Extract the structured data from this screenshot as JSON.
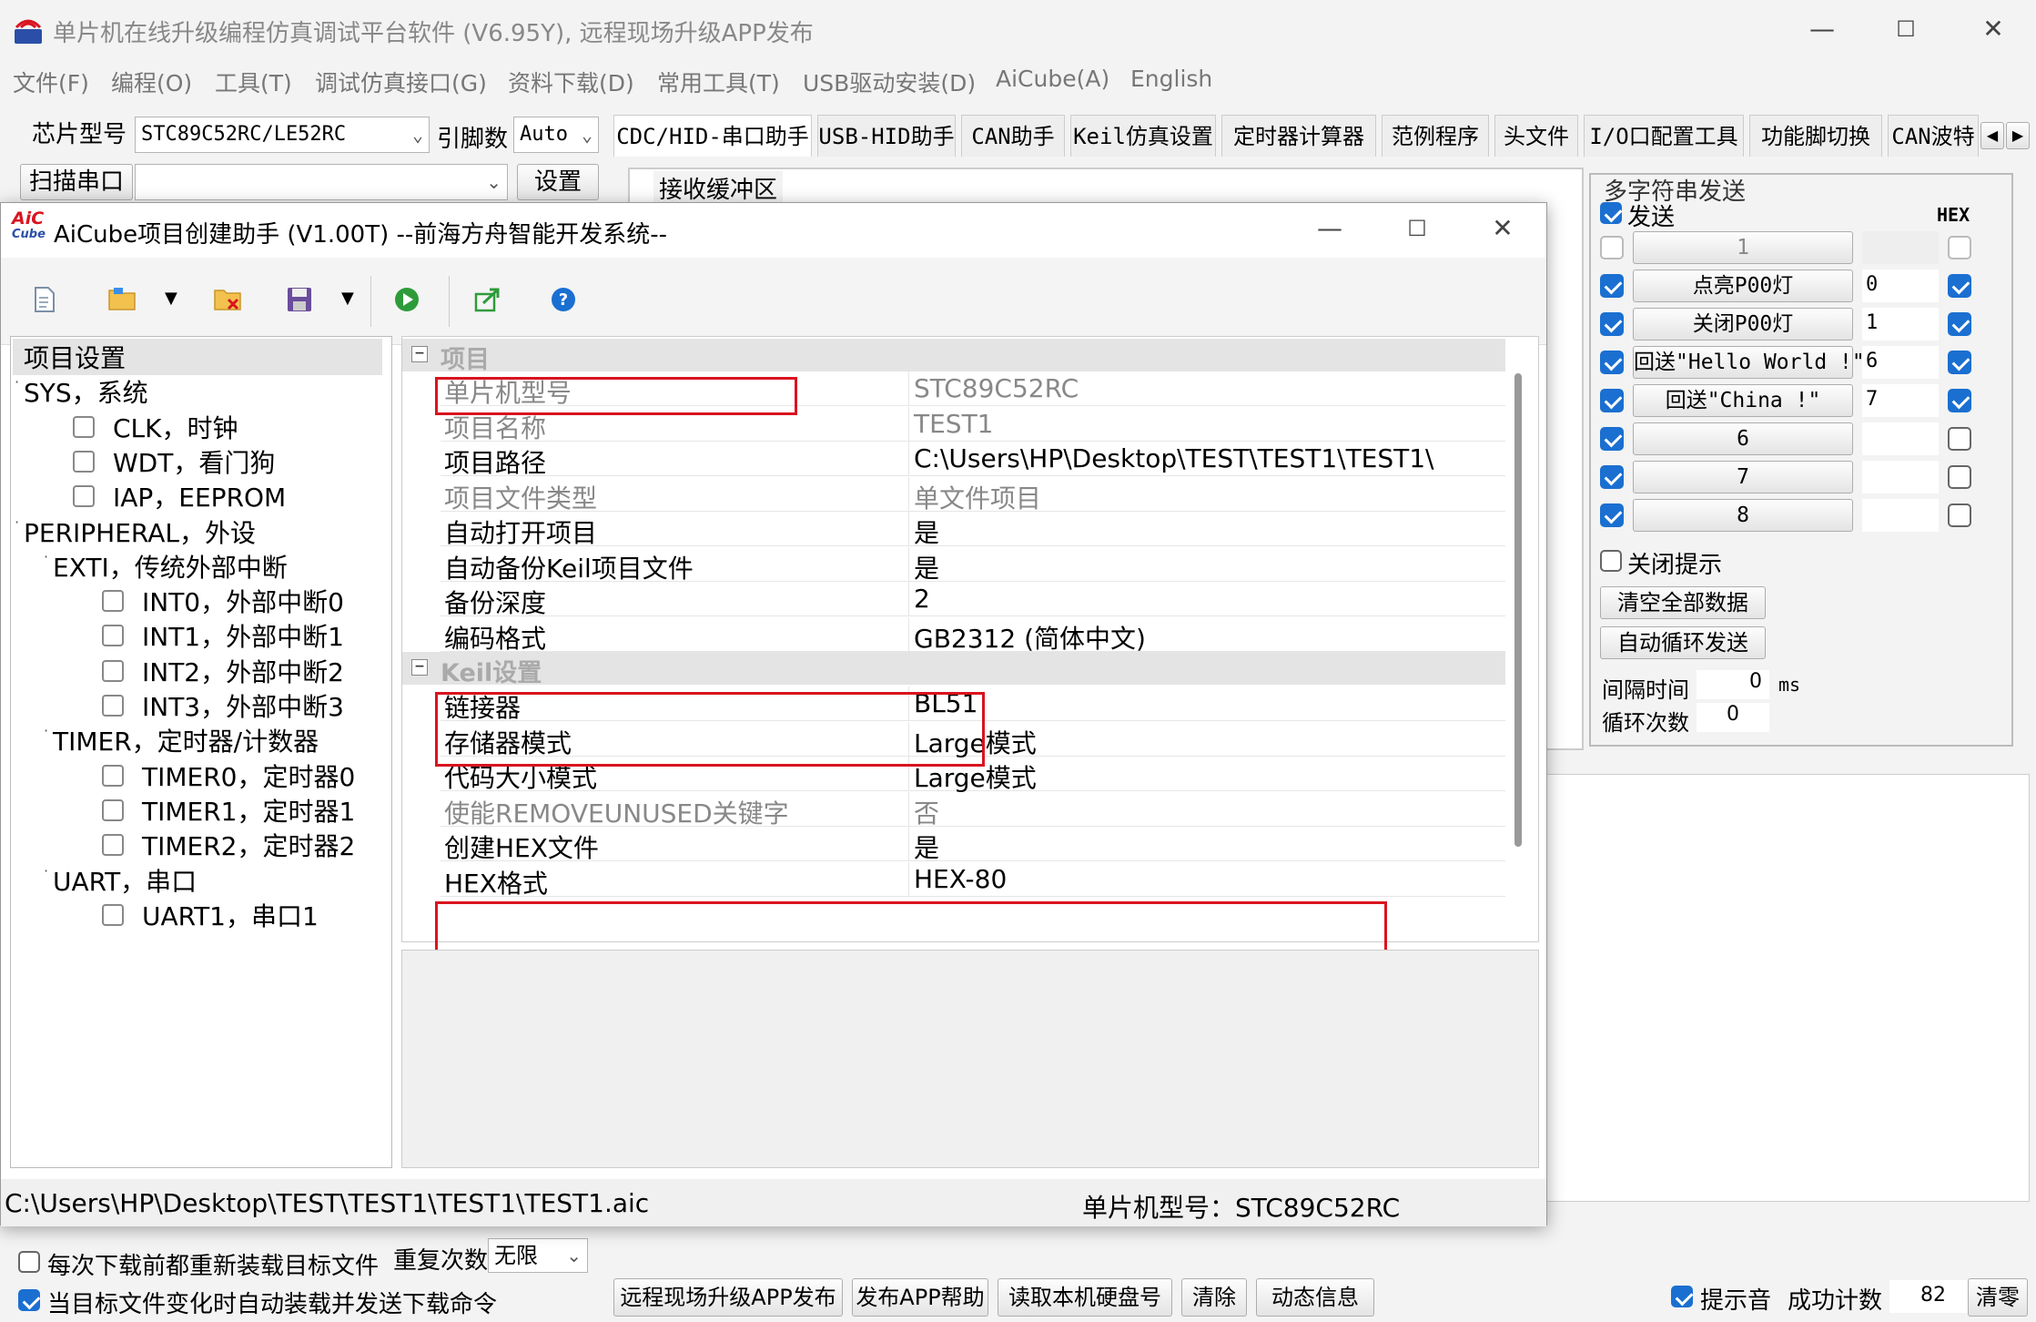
{
  "app": {
    "title": "单片机在线升级编程仿真调试平台软件 (V6.95Y), 远程现场升级APP发布",
    "min": "—",
    "max": "☐",
    "close": "✕"
  },
  "menu": [
    "文件(F)",
    "编程(O)",
    "工具(T)",
    "调试仿真接口(G)",
    "资料下载(D)",
    "常用工具(T)",
    "USB驱动安装(D)",
    "AiCube(A)",
    "English"
  ],
  "left_panel": {
    "chip_label": "芯片型号",
    "chip_value": "STC89C52RC/LE52RC",
    "pin_label": "引脚数",
    "pin_value": "Auto",
    "scan_label": "扫描串口",
    "set_label": "设置"
  },
  "tabs": [
    "CDC/HID-串口助手",
    "USB-HID助手",
    "CAN助手",
    "Keil仿真设置",
    "定时器计算器",
    "范例程序",
    "头文件",
    "I/O口配置工具",
    "功能脚切换",
    "CAN波特"
  ],
  "recv_label": "接收缓冲区",
  "multi_send": {
    "title": "多字符串发送",
    "send_label": "发送",
    "hex_label": "HEX",
    "rows": [
      {
        "checked": false,
        "label": "1",
        "num": "",
        "hex": false,
        "disabled": true
      },
      {
        "checked": true,
        "label": "点亮P00灯",
        "num": "0",
        "hex": true
      },
      {
        "checked": true,
        "label": "关闭P00灯",
        "num": "1",
        "hex": true
      },
      {
        "checked": true,
        "label": "回送\"Hello World !\"",
        "num": "6",
        "hex": true
      },
      {
        "checked": true,
        "label": "回送\"China !\"",
        "num": "7",
        "hex": true
      },
      {
        "checked": true,
        "label": "6",
        "num": "",
        "hex": false
      },
      {
        "checked": true,
        "label": "7",
        "num": "",
        "hex": false
      },
      {
        "checked": true,
        "label": "8",
        "num": "",
        "hex": false
      }
    ],
    "close_tip": "关闭提示",
    "clear_all": "清空全部数据",
    "auto_loop": "自动循环发送",
    "interval_label": "间隔时间",
    "interval_value": "0",
    "interval_unit": "ms",
    "loop_label": "循环次数",
    "loop_value": "0"
  },
  "bottom": {
    "reload_label": "每次下载前都重新装载目标文件",
    "auto_send_label": "当目标文件变化时自动装载并发送下载命令",
    "retry_label": "重复次数",
    "retry_value": "无限",
    "buttons": [
      "远程现场升级APP发布",
      "发布APP帮助",
      "读取本机硬盘号",
      "清除",
      "动态信息"
    ],
    "tip_sound": "提示音",
    "success_label": "成功计数",
    "success_value": "82",
    "clear_label": "清零"
  },
  "dialog": {
    "title": "AiCube项目创建助手 (V1.00T) --前海方舟智能开发系统--",
    "logo_top": "AiC",
    "logo_bottom": "Cube",
    "tree": [
      {
        "label": "项目设置",
        "level": 0,
        "cb": false,
        "arrow": false,
        "sel": true
      },
      {
        "label": "SYS，系统",
        "level": 0,
        "cb": false,
        "arrow": true
      },
      {
        "label": "CLK，时钟",
        "level": 1,
        "cb": true
      },
      {
        "label": "WDT，看门狗",
        "level": 1,
        "cb": true
      },
      {
        "label": "IAP，EEPROM",
        "level": 1,
        "cb": true
      },
      {
        "label": "PERIPHERAL，外设",
        "level": 0,
        "cb": false,
        "arrow": true
      },
      {
        "label": "EXTI，传统外部中断",
        "level": 1,
        "cb": false,
        "arrow": true
      },
      {
        "label": "INT0，外部中断0",
        "level": 2,
        "cb": true
      },
      {
        "label": "INT1，外部中断1",
        "level": 2,
        "cb": true
      },
      {
        "label": "INT2，外部中断2",
        "level": 2,
        "cb": true
      },
      {
        "label": "INT3，外部中断3",
        "level": 2,
        "cb": true
      },
      {
        "label": "TIMER，定时器/计数器",
        "level": 1,
        "cb": false,
        "arrow": true
      },
      {
        "label": "TIMER0，定时器0",
        "level": 2,
        "cb": true
      },
      {
        "label": "TIMER1，定时器1",
        "level": 2,
        "cb": true
      },
      {
        "label": "TIMER2，定时器2",
        "level": 2,
        "cb": true
      },
      {
        "label": "UART，串口",
        "level": 1,
        "cb": false,
        "arrow": true
      },
      {
        "label": "UART1，串口1",
        "level": 2,
        "cb": true
      }
    ],
    "categories": {
      "project": "项目",
      "keil": "Keil设置"
    },
    "props": [
      {
        "k": "单片机型号",
        "v": "STC89C52RC",
        "dim": true
      },
      {
        "k": "项目名称",
        "v": "TEST1",
        "dim": true
      },
      {
        "k": "项目路径",
        "v": "C:\\Users\\HP\\Desktop\\TEST\\TEST1\\TEST1\\",
        "dim": false
      },
      {
        "k": "项目文件类型",
        "v": "单文件项目",
        "dim": true
      },
      {
        "k": "自动打开项目",
        "v": "是",
        "dim": false
      },
      {
        "k": "自动备份Keil项目文件",
        "v": "是",
        "dim": false
      },
      {
        "k": "备份深度",
        "v": "2",
        "dim": false
      },
      {
        "k": "编码格式",
        "v": "GB2312 (简体中文)",
        "dim": false
      },
      {
        "k": "链接器",
        "v": "BL51",
        "dim": false
      },
      {
        "k": "存储器模式",
        "v": "Large模式",
        "dim": false
      },
      {
        "k": "代码大小模式",
        "v": "Large模式",
        "dim": false
      },
      {
        "k": "使能REMOVEUNUSED关键字",
        "v": "否",
        "dim": true
      },
      {
        "k": "创建HEX文件",
        "v": "是",
        "dim": false
      },
      {
        "k": "HEX格式",
        "v": "HEX-80",
        "dim": false
      }
    ],
    "status_path": "C:\\Users\\HP\\Desktop\\TEST\\TEST1\\TEST1\\TEST1.aic",
    "status_chip": "单片机型号：STC89C52RC"
  },
  "colors": {
    "highlight": "#d9141f",
    "accent": "#1a6fd1"
  }
}
